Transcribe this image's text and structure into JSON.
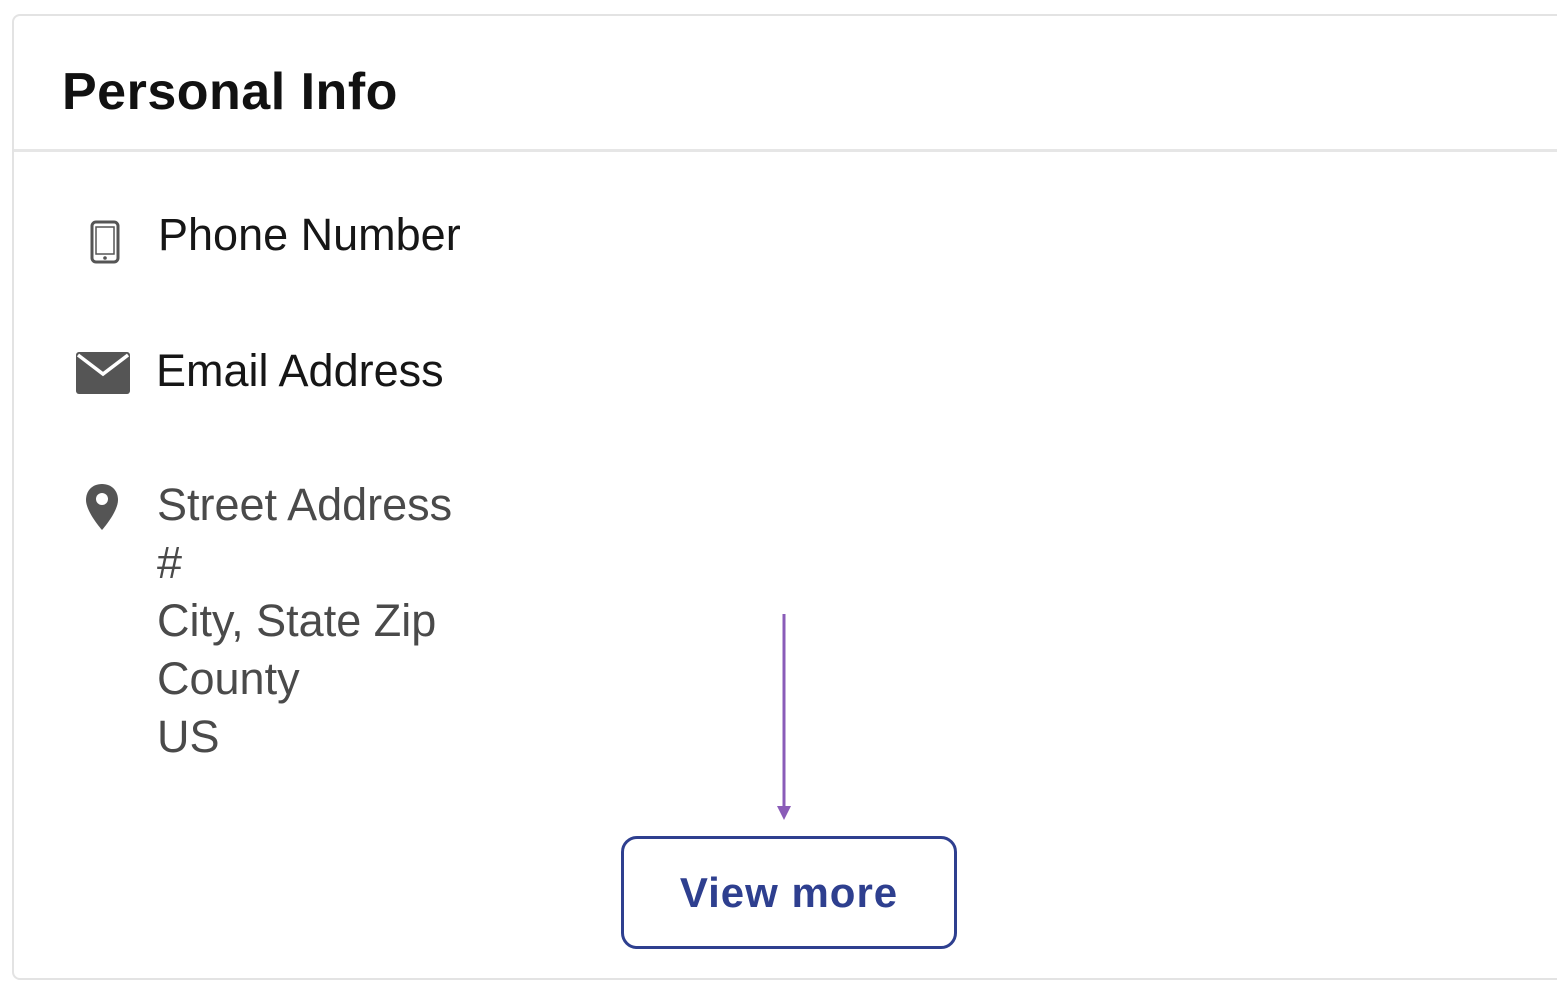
{
  "card": {
    "title": "Personal Info"
  },
  "contact": {
    "phone": {
      "icon": "smartphone-icon",
      "label": "Phone Number"
    },
    "email": {
      "icon": "envelope-icon",
      "label": "Email Address"
    },
    "address": {
      "icon": "map-pin-icon",
      "lines": [
        "Street Address",
        "#",
        "City, State Zip",
        "County",
        "US"
      ]
    }
  },
  "actions": {
    "view_more_label": "View more"
  },
  "colors": {
    "accent": "#2e3f8f",
    "annotation_arrow": "#8a5cb8",
    "icon_gray": "#555555",
    "divider": "#e6e6e6"
  },
  "annotation": {
    "icon": "down-arrow-pointer"
  }
}
